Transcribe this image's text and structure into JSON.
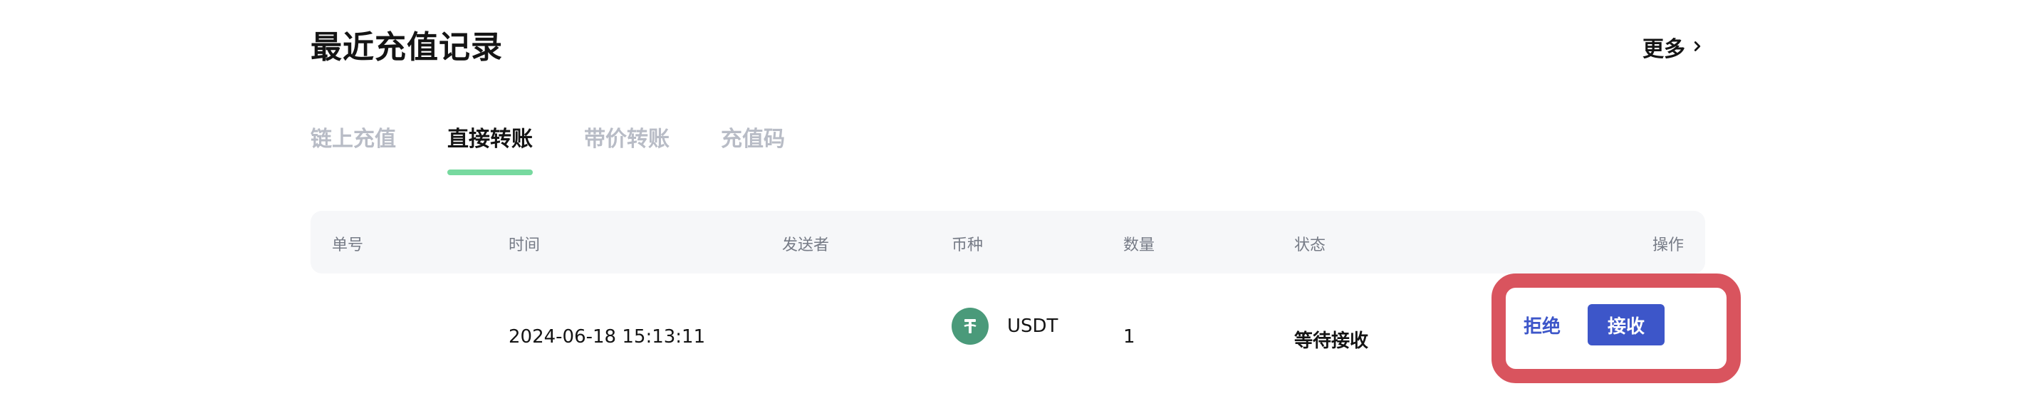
{
  "section": {
    "title": "最近充值记录",
    "more_label": "更多"
  },
  "tabs": [
    {
      "label": "链上充值",
      "active": false
    },
    {
      "label": "直接转账",
      "active": true
    },
    {
      "label": "带价转账",
      "active": false
    },
    {
      "label": "充值码",
      "active": false
    }
  ],
  "table": {
    "columns": [
      "单号",
      "时间",
      "发送者",
      "币种",
      "数量",
      "状态",
      "操作"
    ],
    "rows": [
      {
        "order_no": "",
        "time": "2024-06-18 15:13:11",
        "sender": "",
        "coin": "USDT",
        "amount": "1",
        "status": "等待接收",
        "actions": {
          "reject_label": "拒绝",
          "accept_label": "接收"
        }
      }
    ]
  },
  "colors": {
    "active_tab_underline": "#77d99f",
    "primary": "#3d56c9",
    "highlight_box": "#d9545e",
    "usdt": "#4a9a7a"
  },
  "icons": {
    "more": "chevron-right-icon",
    "coin": "usdt-icon"
  }
}
